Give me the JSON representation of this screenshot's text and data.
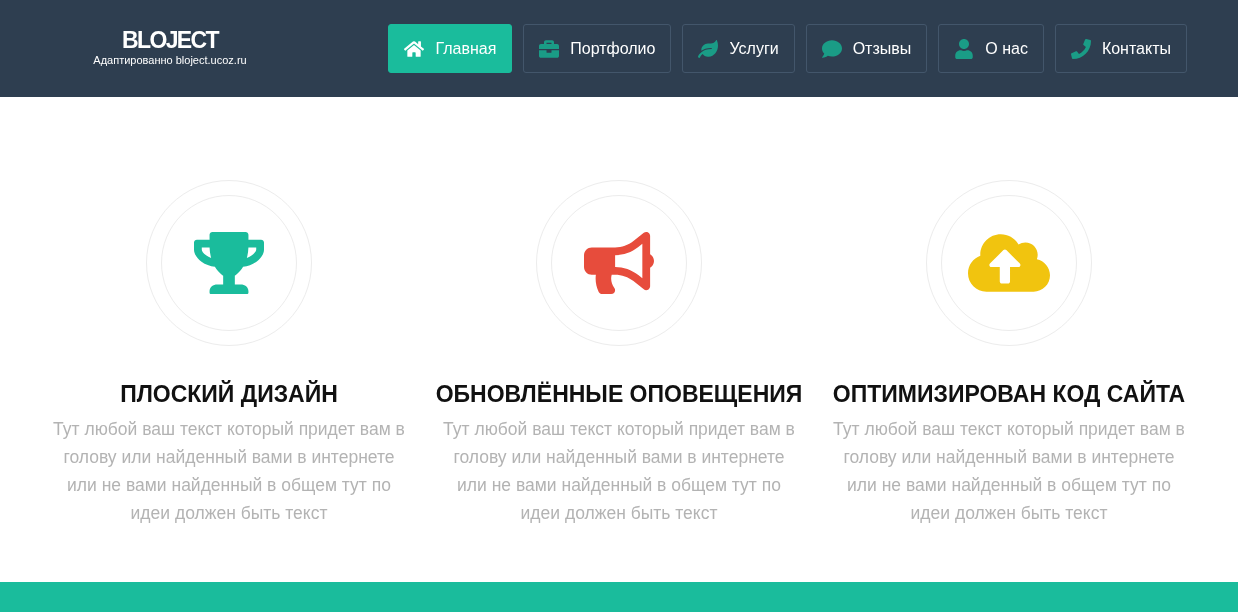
{
  "header": {
    "logo": "BLOJECT",
    "tagline": "Адаптированно bloject.ucoz.ru"
  },
  "nav": {
    "items": [
      {
        "label": "Главная",
        "selected": true
      },
      {
        "label": "Портфолио",
        "selected": false
      },
      {
        "label": "Услуги",
        "selected": false
      },
      {
        "label": "Отзывы",
        "selected": false
      },
      {
        "label": "О нас",
        "selected": false
      },
      {
        "label": "Контакты",
        "selected": false
      }
    ]
  },
  "features": [
    {
      "title": "ПЛОСКИЙ ДИЗАЙН",
      "text": "Тут любой ваш текст который придет вам в голову или найденный вами в интернете или не вами найденный в общем тут по идеи должен быть текст",
      "color": "#1abc9c"
    },
    {
      "title": "ОБНОВЛЁННЫЕ ОПОВЕЩЕНИЯ",
      "text": "Тут любой ваш текст который придет вам в голову или найденный вами в интернете или не вами найденный в общем тут по идеи должен быть текст",
      "color": "#e74c3c"
    },
    {
      "title": "ОПТИМИЗИРОВАН КОД САЙТА",
      "text": "Тут любой ваш текст который придет вам в голову или найденный вами в интернете или не вами найденный в общем тут по идеи должен быть текст",
      "color": "#f1c40f"
    }
  ]
}
